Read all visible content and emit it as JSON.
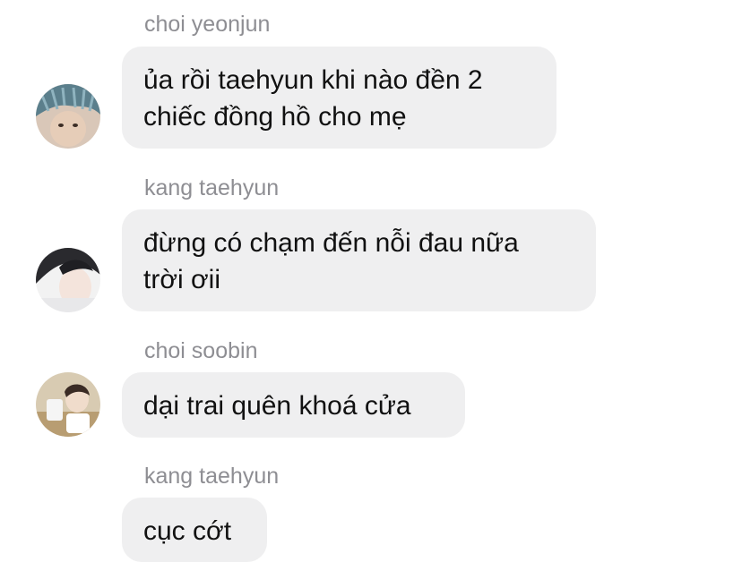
{
  "messages": [
    {
      "sender": "choi yeonjun",
      "lines": [
        "ủa rồi taehyun khi nào đền 2",
        "chiếc đồng hồ cho mẹ"
      ],
      "avatar_icon": "avatar-yeonjun-icon"
    },
    {
      "sender": "kang taehyun",
      "lines": [
        "đừng có chạm đến nỗi đau nữa",
        "trời ơii"
      ],
      "avatar_icon": "avatar-taehyun-icon"
    },
    {
      "sender": "choi soobin",
      "lines": [
        "dại trai quên khoá cửa"
      ],
      "avatar_icon": "avatar-soobin-icon"
    },
    {
      "sender": "kang taehyun",
      "lines": [
        "cục cớt"
      ]
    }
  ],
  "colors": {
    "bubble_bg": "#efeff0",
    "sender_text": "#8e8e93",
    "message_text": "#111111"
  }
}
